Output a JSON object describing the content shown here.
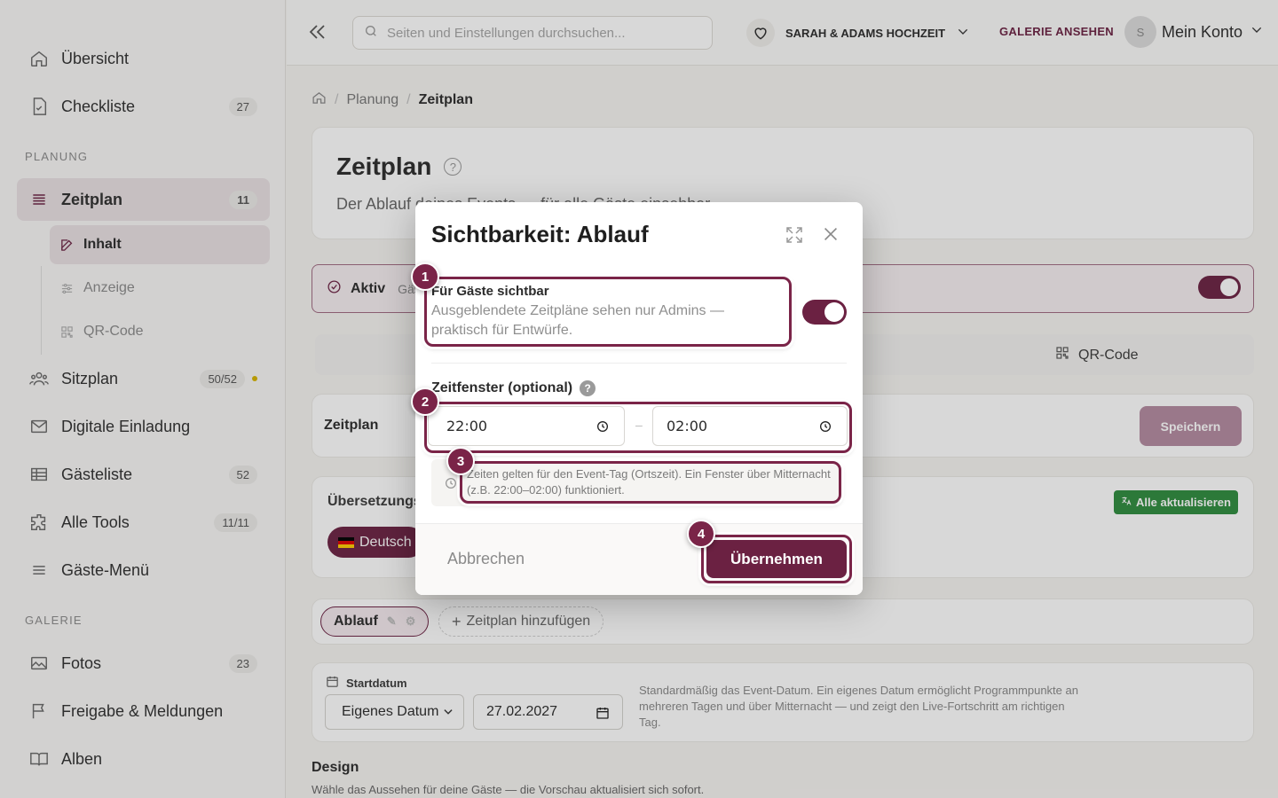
{
  "sidebar": {
    "items": [
      {
        "label": "Übersicht",
        "icon": "home-icon"
      },
      {
        "label": "Checkliste",
        "badge": "27",
        "icon": "checklist-icon"
      }
    ],
    "planning_label": "PLANUNG",
    "planning": [
      {
        "label": "Zeitplan",
        "badge": "11",
        "icon": "list-icon"
      },
      {
        "label": "Sitzplan",
        "badge": "50/52",
        "icon": "people-icon"
      },
      {
        "label": "Digitale Einladung",
        "icon": "mail-icon"
      },
      {
        "label": "Gästeliste",
        "badge": "52",
        "icon": "table-icon"
      },
      {
        "label": "Alle Tools",
        "badge": "11/11",
        "icon": "puzzle-icon"
      },
      {
        "label": "Gäste-Menü",
        "icon": "menu-icon"
      }
    ],
    "sub": [
      {
        "label": "Inhalt",
        "icon": "edit-icon"
      },
      {
        "label": "Anzeige",
        "icon": "sliders-icon"
      },
      {
        "label": "QR-Code",
        "icon": "qr-icon"
      }
    ],
    "gallery_label": "GALERIE",
    "gallery": [
      {
        "label": "Fotos",
        "badge": "23",
        "icon": "image-icon"
      },
      {
        "label": "Freigabe & Meldungen",
        "icon": "flag-icon"
      },
      {
        "label": "Alben",
        "icon": "book-icon"
      }
    ]
  },
  "topbar": {
    "search_placeholder": "Seiten und Einstellungen durchsuchen...",
    "event": "SARAH & ADAMS HOCHZEIT",
    "gallery_link": "GALERIE ANSEHEN",
    "avatar_initial": "S",
    "account": "Mein Konto"
  },
  "breadcrumb": {
    "parent": "Planung",
    "current": "Zeitplan"
  },
  "page": {
    "title": "Zeitplan",
    "help": "?",
    "subtitle": "Der Ablauf deines Events — für alle Gäste einsehbar",
    "status_label": "Aktiv",
    "status_extra": "Gäs",
    "tab_qr": "QR-Code",
    "editor_label": "Zeitplan",
    "save": "Speichern",
    "translations_label": "Übersetzungs",
    "update_all": "Alle aktualisieren",
    "language": "Deutsch",
    "chip_ablauf": "Ablauf",
    "chip_add": "Zeitplan hinzufügen",
    "start_label": "Startdatum",
    "start_select": "Eigenes Datum",
    "start_date": "27.02.2027",
    "start_hint": "Standardmäßig das Event-Datum. Ein eigenes Datum ermöglicht Programmpunkte an mehreren Tagen und über Mitternacht — und zeigt den Live-Fortschritt am richtigen Tag.",
    "design_label": "Design",
    "design_sub": "Wähle das Aussehen für deine Gäste — die Vorschau aktualisiert sich sofort."
  },
  "modal": {
    "title": "Sichtbarkeit: Ablauf",
    "visible_title": "Für Gäste sichtbar",
    "visible_desc": "Ausgeblendete Zeitpläne sehen nur Admins — praktisch für Entwürfe.",
    "visible_on": true,
    "window_label": "Zeitfenster (optional)",
    "window_help": "?",
    "time_from": "22:00",
    "time_to": "02:00",
    "time_sep": "–",
    "hint": "Zeiten gelten für den Event-Tag (Ortszeit). Ein Fenster über Mitternacht (z.B. 22:00–02:00) funktioniert.",
    "cancel": "Abbrechen",
    "apply": "Übernehmen"
  },
  "annotations": [
    "1",
    "2",
    "3",
    "4"
  ],
  "colors": {
    "accent": "#6b2142",
    "success": "#2e8b3e",
    "highlight": "#7a2448"
  }
}
